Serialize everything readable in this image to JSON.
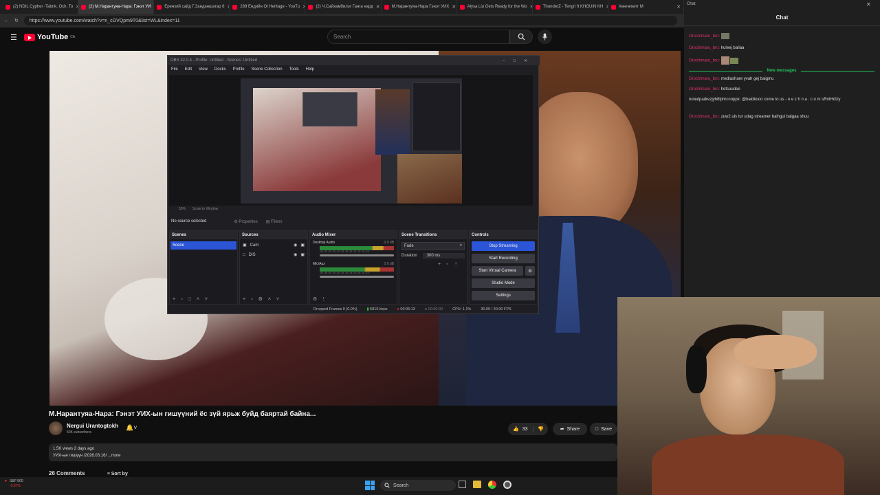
{
  "browser": {
    "tabs": [
      {
        "label": "(2) NDIL Cypher -Tabnk, Och, To"
      },
      {
        "label": "(2) М.Нарантуяа-Нара: Гэнэт УИ",
        "active": true
      },
      {
        "label": "Еренхий сайд Г.Занданшатар 6"
      },
      {
        "label": "289 Ендийн Ol Heritage - YouTu"
      },
      {
        "label": "(2) Ч.Сайхамбилэг Ганга нард"
      },
      {
        "label": "М.Нарантуяа-Нара Гэнэт УИХ"
      },
      {
        "label": "Alysa Liu Gets Ready for the Wo"
      },
      {
        "label": "ThunderZ - Tengri ft KHOUIN KH"
      },
      {
        "label": "Хөнгөлөлт М"
      }
    ],
    "url": "https://www.youtube.com/watch?v=n_cOVQpm9T0&list=WL&index=11"
  },
  "youtube": {
    "logo": "YouTube",
    "country": "CA",
    "search_placeholder": "Search"
  },
  "obs": {
    "title": "OBS 32.0.4 - Profile: Untitled - Scenes: Untitled",
    "menu": [
      "File",
      "Edit",
      "View",
      "Docks",
      "Profile",
      "Scene Collection",
      "Tools",
      "Help"
    ],
    "preview_footer": [
      "55%",
      "Scale to Window"
    ],
    "no_source": "No source selected",
    "properties": "Properties",
    "filters": "Filters",
    "scenes": {
      "title": "Scenes",
      "items": [
        "Scene"
      ]
    },
    "sources": {
      "title": "Sources",
      "items": [
        "Cam",
        "DIS"
      ]
    },
    "audio": {
      "title": "Audio Mixer",
      "tracks": [
        {
          "name": "Desktop Audio",
          "db": "0.0 dB"
        },
        {
          "name": "Mic/Aux",
          "db": "0.0 dB"
        }
      ],
      "scale": "-60 -55 -50 -45 -40 -35 -30 -25 -20 -15 -10 -5 0"
    },
    "transitions": {
      "title": "Scene Transitions",
      "type": "Fade",
      "duration_label": "Duration",
      "duration": "300 ms"
    },
    "controls": {
      "title": "Controls",
      "stop_streaming": "Stop Streaming",
      "start_recording": "Start Recording",
      "start_virtual_camera": "Start Virtual Camera",
      "studio_mode": "Studio Mode",
      "settings": "Settings"
    },
    "status": {
      "dropped": "Dropped Frames 0 (0.0%)",
      "bitrate": "5816 kbps",
      "stream_time": "00:05:13",
      "rec_time": "00:00:00",
      "cpu": "CPU: 1.1%",
      "fps": "30.00 / 30.00 FPS"
    }
  },
  "video": {
    "title": "М.Нарантуяа-Нара: Гэнэт УИХ-ын гишүүний ёс зүй ярьж буйд баяртай байна...",
    "channel": "Nergui Urantogtokh",
    "subscribers": "50K subscribers",
    "likes": "33",
    "share": "Share",
    "save": "Save",
    "views": "1.5K views  2 days ago",
    "desc": "УИХ-ын гишүүн /2026.03.16/ ...more",
    "comments": "26 Comments",
    "sort": "Sort by"
  },
  "chat": {
    "window_label": "Chat",
    "title": "Chat",
    "new_messages": "New messages",
    "messages": [
      {
        "user": "Orochimaru_bro:",
        "text": ""
      },
      {
        "user": "Orochimaru_bro:",
        "text": "huleej bailaa"
      },
      {
        "user": "Orochimaru_bro:",
        "text": ""
      },
      {
        "user": "Orochimaru_bro:",
        "text": "mediashare yvah gej baigmu"
      },
      {
        "user": "Orochimaru_bro:",
        "text": "hetsuudee"
      },
      {
        "user": "notedpadrezjyh8lphrcnnppk:",
        "text": "@baldkooo come to us - n e z h n a . c o m sRntHdUy"
      },
      {
        "user": "Orochimaru_bro:",
        "text": "zuw2 uls tur udag streamer baihgui baigaa shuu"
      }
    ]
  },
  "taskbar": {
    "ticker_name": "S&P 500",
    "ticker_change": "-0.67%",
    "search": "Search"
  },
  "colors": {
    "accent": "#2b54d6",
    "youtube_red": "#ff0033",
    "chat_user": "#e0306a",
    "new_messages": "#22c55e"
  }
}
